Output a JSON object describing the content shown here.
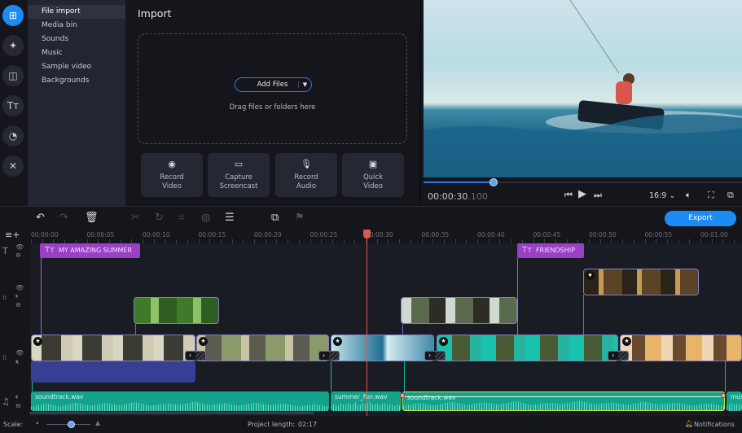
{
  "sidebar": {
    "rail": [
      {
        "icon": "import-folder-icon",
        "active": true
      },
      {
        "icon": "magic-wand-icon"
      },
      {
        "icon": "transitions-icon"
      },
      {
        "icon": "text-titles-icon"
      },
      {
        "icon": "stickers-icon"
      },
      {
        "icon": "tools-icon"
      }
    ],
    "items": [
      {
        "label": "File import",
        "active": true
      },
      {
        "label": "Media bin"
      },
      {
        "label": "Sounds"
      },
      {
        "label": "Music"
      },
      {
        "label": "Sample video"
      },
      {
        "label": "Backgrounds"
      }
    ]
  },
  "import": {
    "title": "Import",
    "add_files": "Add Files",
    "drag_text": "Drag files or folders here",
    "quick_buttons": [
      {
        "line1": "Record",
        "line2": "Video",
        "icon": "webcam-icon"
      },
      {
        "line1": "Capture",
        "line2": "Screencast",
        "icon": "monitor-icon"
      },
      {
        "line1": "Record",
        "line2": "Audio",
        "icon": "microphone-icon"
      },
      {
        "line1": "Quick",
        "line2": "Video",
        "icon": "quick-video-icon"
      }
    ]
  },
  "player": {
    "timecode": "00:00:30",
    "timecode_ms": ".100",
    "aspect_ratio": "16:9",
    "progress": 0.22
  },
  "toolbar": {
    "export_label": "Export"
  },
  "ruler": {
    "labels": [
      "00:00:00",
      "00:00:05",
      "00:00:10",
      "00:00:15",
      "00:00:20",
      "00:00:25",
      "00:00:30",
      "00:00:35",
      "00:00:40",
      "00:00:45",
      "00:00:50",
      "00:00:55",
      "00:01:00"
    ]
  },
  "timeline": {
    "titles": [
      "MY AMAZING SUMMER",
      "FRIENDSHIP"
    ],
    "audio_clips": [
      "soundtrack.wav",
      "summer_fun.wav",
      "soundtrack.wav",
      "mus"
    ]
  },
  "status": {
    "scale_label": "Scale:",
    "scale_value": 0.55,
    "project_length_label": "Project length:",
    "project_length": "02:17",
    "notifications": "Notifications"
  },
  "colors": {
    "accent": "#1b8cf5",
    "title_clip": "#9b3fc6",
    "audio_clip": "#13a38a",
    "playhead": "#e2544f"
  }
}
